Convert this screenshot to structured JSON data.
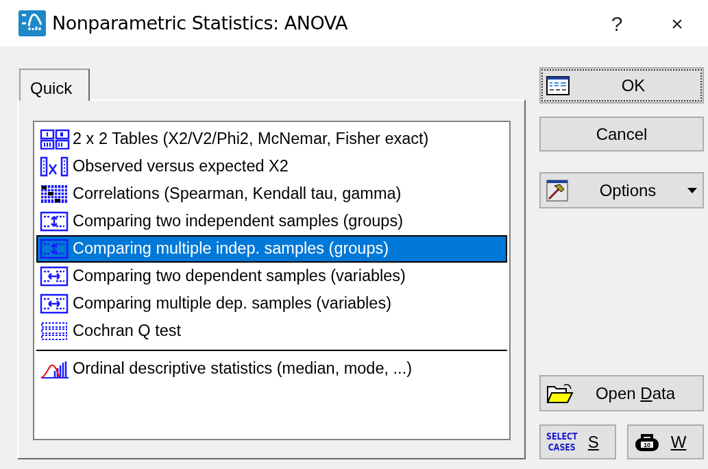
{
  "window": {
    "title": "Nonparametric Statistics: ANOVA",
    "help": "?",
    "close": "×"
  },
  "tabs": [
    {
      "label": "Quick",
      "selected": true
    }
  ],
  "list": [
    {
      "label": "2 x 2 Tables (X2/V2/Phi2, McNemar, Fisher exact)",
      "selected": false,
      "separator_before": false
    },
    {
      "label": "Observed versus expected X2",
      "selected": false,
      "separator_before": false
    },
    {
      "label": "Correlations (Spearman, Kendall tau, gamma)",
      "selected": false,
      "separator_before": false
    },
    {
      "label": "Comparing two independent samples (groups)",
      "selected": false,
      "separator_before": false
    },
    {
      "label": "Comparing multiple indep. samples (groups)",
      "selected": true,
      "separator_before": false
    },
    {
      "label": "Comparing two dependent samples (variables)",
      "selected": false,
      "separator_before": false
    },
    {
      "label": "Comparing multiple dep. samples (variables)",
      "selected": false,
      "separator_before": false
    },
    {
      "label": "Cochran Q test",
      "selected": false,
      "separator_before": false
    },
    {
      "label": "Ordinal descriptive statistics (median, mode, ...)",
      "selected": false,
      "separator_before": true
    }
  ],
  "buttons": {
    "ok": {
      "label": "OK",
      "focused": true
    },
    "cancel": {
      "label": "Cancel"
    },
    "options": {
      "label": "Options"
    },
    "open_data": {
      "before": "Open ",
      "key": "D",
      "after": "ata"
    },
    "select_cases": {
      "icon_text": [
        "SELECT",
        "CASES"
      ],
      "key": "S"
    },
    "weight": {
      "icon_text": "10",
      "key": "W"
    }
  }
}
